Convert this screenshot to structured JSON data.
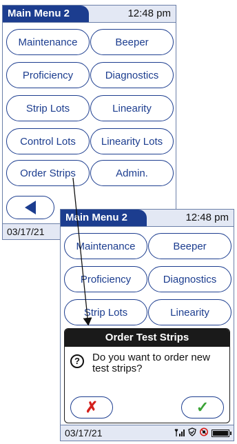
{
  "screen1": {
    "title": "Main Menu 2",
    "time": "12:48 pm",
    "buttons": [
      {
        "label": "Maintenance"
      },
      {
        "label": "Beeper"
      },
      {
        "label": "Proficiency"
      },
      {
        "label": "Diagnostics"
      },
      {
        "label": "Strip Lots"
      },
      {
        "label": "Linearity"
      },
      {
        "label": "Control Lots"
      },
      {
        "label": "Linearity Lots"
      },
      {
        "label": "Order Strips"
      },
      {
        "label": "Admin."
      }
    ],
    "date": "03/17/21"
  },
  "screen2": {
    "title": "Main Menu 2",
    "time": "12:48 pm",
    "buttons": [
      {
        "label": "Maintenance"
      },
      {
        "label": "Beeper"
      },
      {
        "label": "Proficiency"
      },
      {
        "label": "Diagnostics"
      },
      {
        "label": "Strip Lots"
      },
      {
        "label": "Linearity"
      }
    ],
    "dialog": {
      "title": "Order Test Strips",
      "message": "Do you want to order new test strips?",
      "question_icon": "?",
      "cancel_label": "✗",
      "ok_label": "✓"
    },
    "date": "03/17/21",
    "status_icons": [
      "signal-icon",
      "shield-icon",
      "no-entry-icon",
      "battery-icon"
    ]
  },
  "colors": {
    "navy": "#1c3d8f",
    "header_bg": "#e3e8f4",
    "cancel": "#d4201c",
    "ok": "#3aa335"
  }
}
